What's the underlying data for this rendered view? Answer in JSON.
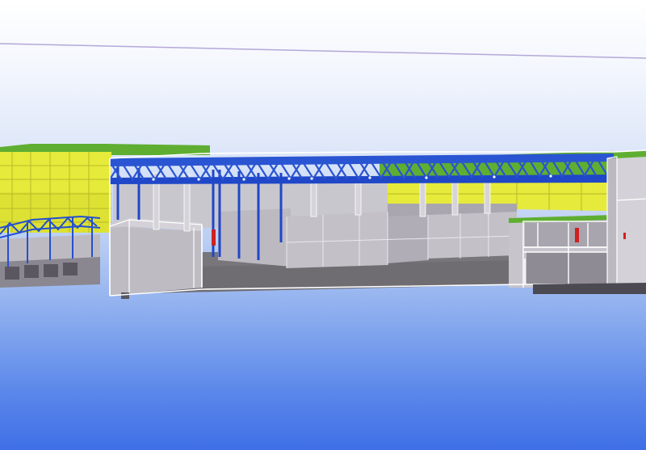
{
  "viewport": {
    "background_top": "#ffffff",
    "background_bottom": "#3f6fe6"
  },
  "colors": {
    "roof_green": "#5fae32",
    "wall_yellow": "#e6ea3a",
    "wall_yellow_dark": "#cfd32c",
    "steel_blue": "#1f47c8",
    "concrete": "#b7b4bd",
    "concrete_dark": "#8d8a93",
    "floor": "#6f6c72",
    "edge": "#ffffff",
    "door_red": "#d02020"
  },
  "scene": {
    "icons": [
      "axis-guide-line",
      "roof-truss-icon",
      "steel-column-icon",
      "section-box-icon"
    ]
  }
}
